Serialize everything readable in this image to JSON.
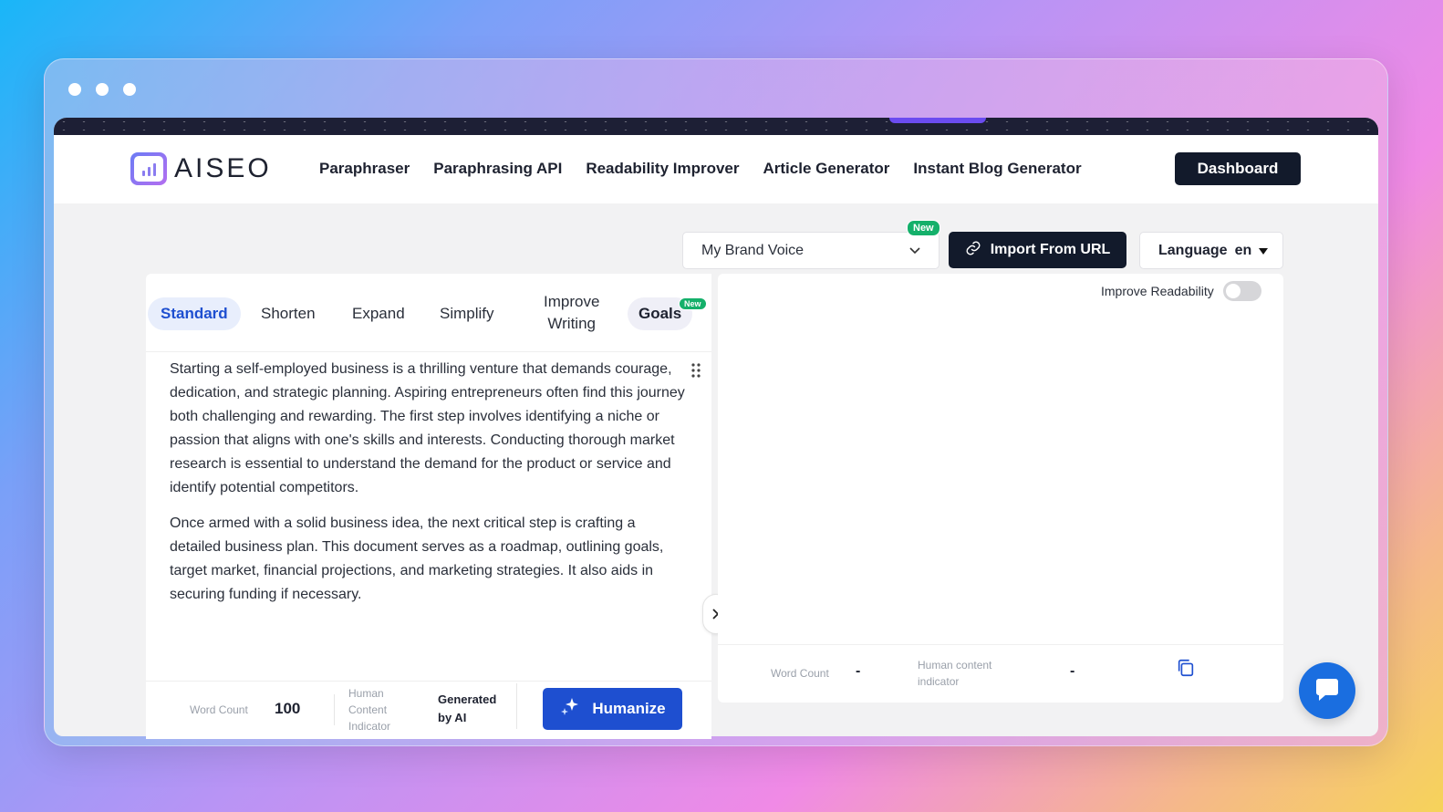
{
  "brand": {
    "name": "AISEO"
  },
  "nav": {
    "links": [
      "Paraphraser",
      "Paraphrasing API",
      "Readability Improver",
      "Article Generator",
      "Instant Blog Generator"
    ],
    "dashboard_label": "Dashboard"
  },
  "controls": {
    "brand_voice": "My Brand Voice",
    "new_badge": "New",
    "import_label": "Import From URL",
    "language_label": "Language",
    "language_value": "en"
  },
  "tabs": {
    "standard": "Standard",
    "shorten": "Shorten",
    "expand": "Expand",
    "simplify": "Simplify",
    "improve_line1": "Improve",
    "improve_line2": "Writing",
    "goals": "Goals",
    "goals_badge": "New"
  },
  "editor": {
    "paragraph1": "Starting a self-employed business is a thrilling venture that demands courage, dedication, and strategic planning. Aspiring entrepreneurs often find this journey both challenging and rewarding. The first step involves identifying a niche or passion that aligns with one's skills and interests. Conducting thorough market research is essential to understand the demand for the product or service and identify potential competitors.",
    "paragraph2": "Once armed with a solid business idea, the next critical step is crafting a detailed business plan. This document serves as a roadmap, outlining goals, target market, financial projections, and marketing strategies. It also aids in securing funding if necessary."
  },
  "left_footer": {
    "word_count_label": "Word Count",
    "word_count_value": "100",
    "human_label_1": "Human",
    "human_label_2": "Content",
    "human_label_3": "Indicator",
    "generated_1": "Generated",
    "generated_2": "by AI",
    "humanize_label": "Humanize"
  },
  "right_panel": {
    "readability_label": "Improve Readability",
    "word_count_label": "Word Count",
    "word_count_value": "-",
    "human_label_1": "Human content",
    "human_label_2": "indicator",
    "human_value": "-"
  },
  "colors": {
    "primary": "#1e4fd0",
    "dark": "#121a2b",
    "badge_green": "#14b06a",
    "chat_blue": "#1a6ee0"
  }
}
